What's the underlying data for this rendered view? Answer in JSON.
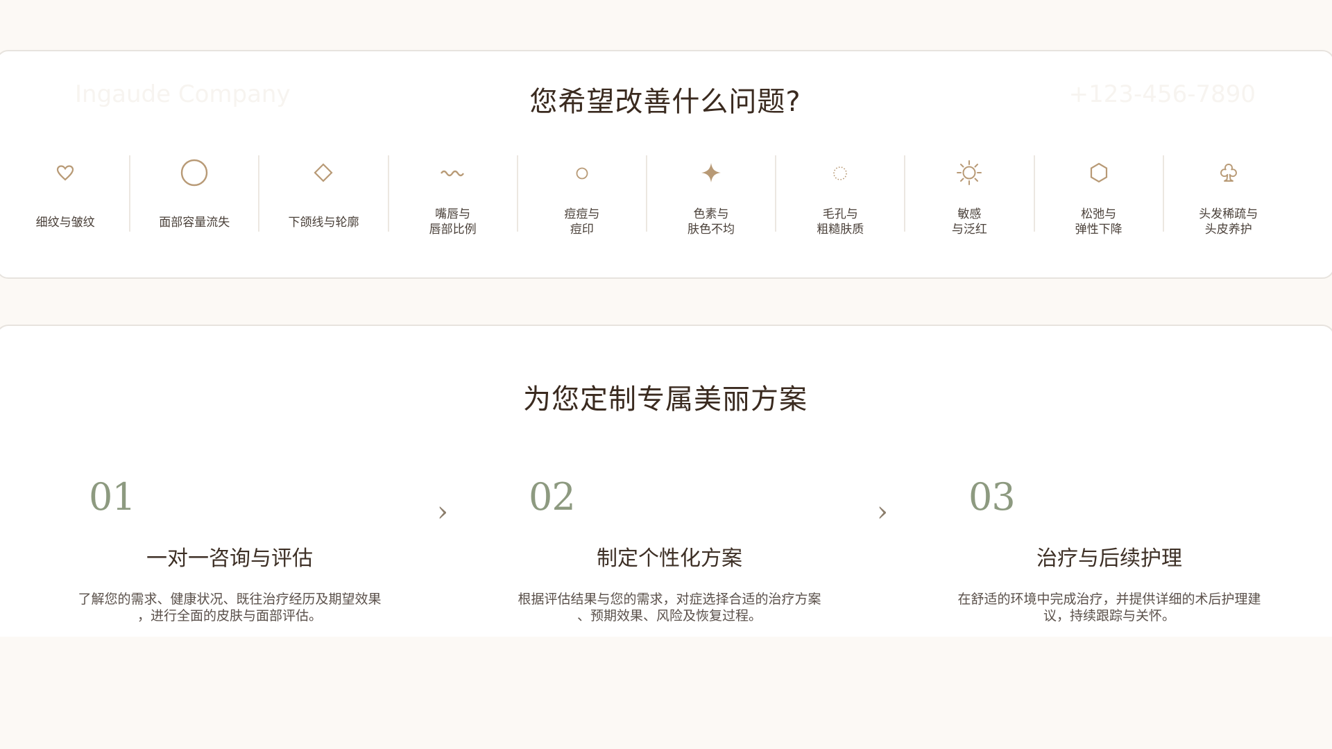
{
  "concerns_section": {
    "ghost_left": "Ingaude Company",
    "ghost_right": "+123-456-7890",
    "title": "您希望改善什么问题?",
    "items": [
      {
        "label": "细纹与皱纹",
        "icon": "heart-outline-icon"
      },
      {
        "label": "面部容量流失",
        "icon": "circle-outline-icon"
      },
      {
        "label": "下颌线与轮廓",
        "icon": "diamond-outline-icon"
      },
      {
        "label": "嘴唇与\n唇部比例",
        "icon": "wave-icon"
      },
      {
        "label": "痘痘与\n痘印",
        "icon": "small-circle-icon"
      },
      {
        "label": "色素与\n肤色不均",
        "icon": "four-point-star-icon"
      },
      {
        "label": "毛孔与\n粗糙肤质",
        "icon": "dotted-circle-icon"
      },
      {
        "label": "敏感\n与泛红",
        "icon": "sun-icon"
      },
      {
        "label": "松弛与\n弹性下降",
        "icon": "hexagon-outline-icon"
      },
      {
        "label": "头发稀疏与\n头皮养护",
        "icon": "club-outline-icon"
      }
    ]
  },
  "plan_section": {
    "title": "为您定制专属美丽方案",
    "steps": [
      {
        "number": "01",
        "title": "一对一咨询与评估",
        "description": "了解您的需求、健康状况、既往治疗经历及期望效果\n，进行全面的皮肤与面部评估。"
      },
      {
        "number": "02",
        "title": "制定个性化方案",
        "description": "根据评估结果与您的需求，对症选择合适的治疗方案\n、预期效果、风险及恢复过程。"
      },
      {
        "number": "03",
        "title": "治疗与后续护理",
        "description": "在舒适的环境中完成治疗，并提供详细的术后护理建\n议，持续跟踪与关怀。"
      }
    ],
    "arrow_glyph": "›"
  },
  "colors": {
    "accent_icon": "#b89a76",
    "step_number": "#8d9a80",
    "page_background": "#fcf9f5",
    "card_background": "#ffffff"
  }
}
